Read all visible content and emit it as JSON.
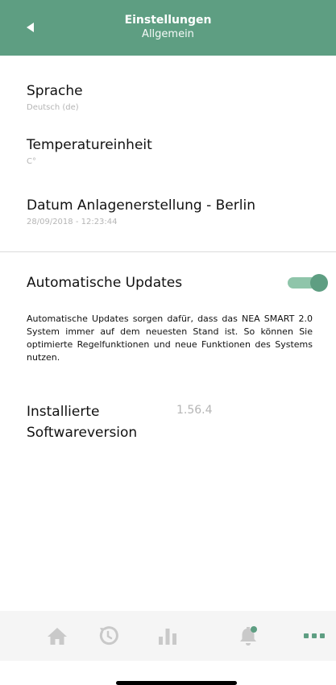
{
  "header": {
    "title": "Einstellungen",
    "subtitle": "Allgemein",
    "back_icon": "back-arrow-icon"
  },
  "settings": [
    {
      "label": "Sprache",
      "value": "Deutsch (de)"
    },
    {
      "label": "Temperatureinheit",
      "value": "C°"
    },
    {
      "label": "Datum Anlagenerstellung - Berlin",
      "value": "28/09/2018 - 12:23:44"
    }
  ],
  "updates": {
    "label": "Automatische Updates",
    "enabled": true,
    "description": "Automatische Updates sorgen dafür, dass das NEA SMART 2.0 System immer auf dem neuesten Stand ist. So können Sie optimierte Regelfunktionen und neue Funktionen des Systems nutzen."
  },
  "software": {
    "label": "Installierte Softwareversion",
    "version": "1.56.4"
  },
  "bottom_nav": {
    "items": [
      {
        "icon": "home-icon"
      },
      {
        "icon": "history-icon"
      },
      {
        "icon": "statistics-icon"
      },
      {
        "icon": "notifications-icon"
      },
      {
        "icon": "more-icon",
        "active": true
      }
    ]
  },
  "colors": {
    "accent": "#5e9e82",
    "toggle_track": "#8fc5aa",
    "nav_inactive": "#c9c9c9",
    "muted_text": "#b5b5b5"
  }
}
